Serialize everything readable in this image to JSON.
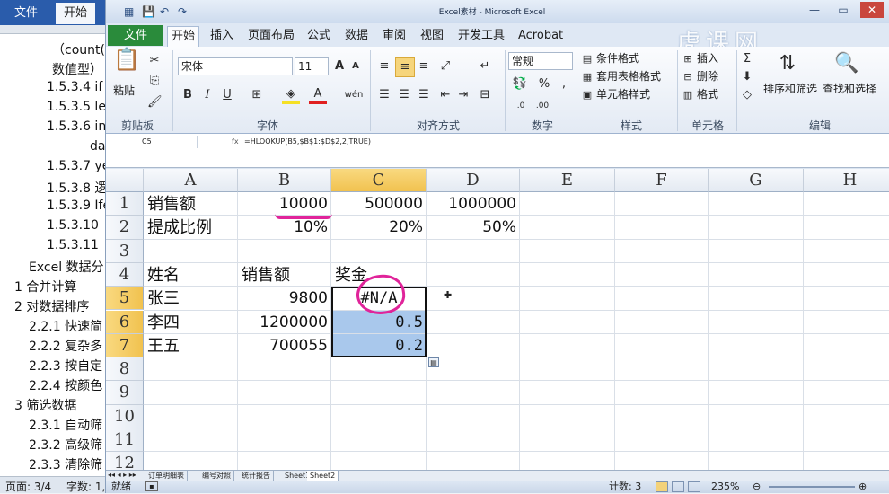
{
  "word": {
    "ribbon_tabs": [
      "文件",
      "开始"
    ],
    "toc": [
      {
        "text": "（count(",
        "indent": 1
      },
      {
        "text": "数值型）",
        "indent": 1
      },
      {
        "text": "1.5.3.4 if",
        "indent": 2
      },
      {
        "text": "1.5.3.5 le",
        "indent": 2
      },
      {
        "text": "1.5.3.6 in",
        "indent": 2
      },
      {
        "text": "da",
        "indent": 3
      },
      {
        "text": "1.5.3.7 ye",
        "indent": 2
      },
      {
        "text": "1.5.3.8 逻",
        "indent": 2
      },
      {
        "text": "1.5.3.9 Ife",
        "indent": 2
      },
      {
        "text": "1.5.3.10",
        "indent": 2
      },
      {
        "text": "1.5.3.11",
        "indent": 2
      },
      {
        "text": "Excel 数据分",
        "indent": 0
      },
      {
        "text": "1    合并计算",
        "indent": -1
      },
      {
        "text": "2    对数据排序",
        "indent": -1
      },
      {
        "text": "2.2.1 快速简",
        "indent": 4
      },
      {
        "text": "2.2.2 复杂多",
        "indent": 4
      },
      {
        "text": "2.2.3 按自定",
        "indent": 4
      },
      {
        "text": "2.2.4 按颜色",
        "indent": 4
      },
      {
        "text": "3    筛选数据",
        "indent": -1
      },
      {
        "text": "2.3.1 自动筛",
        "indent": 4
      },
      {
        "text": "2.3.2 高级筛",
        "indent": 4
      },
      {
        "text": "2.3.3 清除筛",
        "indent": 4
      }
    ],
    "status_page": "页面: 3/4",
    "status_words": "字数: 1,"
  },
  "excel": {
    "title": "Excel素材 - Microsoft Excel",
    "file_tab": "文件",
    "tabs": [
      "开始",
      "插入",
      "页面布局",
      "公式",
      "数据",
      "审阅",
      "视图",
      "开发工具",
      "Acrobat"
    ],
    "watermark": "虎课网",
    "ribbon": {
      "paste": "粘贴",
      "clipboard": "剪贴板",
      "font_name": "宋体",
      "font_size": "11",
      "font": "字体",
      "alignment": "对齐方式",
      "number_format": "常规",
      "number": "数字",
      "cond_format": "条件格式",
      "table_format": "套用表格格式",
      "cell_style": "单元格样式",
      "style": "样式",
      "insert": "插入",
      "delete": "删除",
      "format": "格式",
      "cells": "单元格",
      "sort_filter": "排序和筛选",
      "find_select": "查找和选择",
      "edit": "编辑"
    },
    "name_box": "C5",
    "formula": "=HLOOKUP(B5,$B$1:$D$2,2,TRUE)",
    "columns": [
      "A",
      "B",
      "C",
      "D",
      "E",
      "F",
      "G",
      "H"
    ],
    "rows": [
      "1",
      "2",
      "3",
      "4",
      "5",
      "6",
      "7",
      "8",
      "9",
      "10",
      "11",
      "12"
    ],
    "cells": {
      "A1": "销售额",
      "B1": "10000",
      "C1": "500000",
      "D1": "1000000",
      "A2": "提成比例",
      "B2": "10%",
      "C2": "20%",
      "D2": "50%",
      "A4": "姓名",
      "B4": "销售额",
      "C4": "奖金",
      "A5": "张三",
      "B5": "9800",
      "C5": "#N/A",
      "A6": "李四",
      "B6": "1200000",
      "C6": "0.5",
      "A7": "王五",
      "B7": "700055",
      "C7": "0.2"
    },
    "sheets": [
      "订单明细表",
      "编号对照",
      "统计报告",
      "Sheet1",
      "Sheet2"
    ],
    "active_sheet": "Sheet2",
    "status_ready": "就绪",
    "status_count": "计数: 3",
    "zoom": "235%"
  }
}
